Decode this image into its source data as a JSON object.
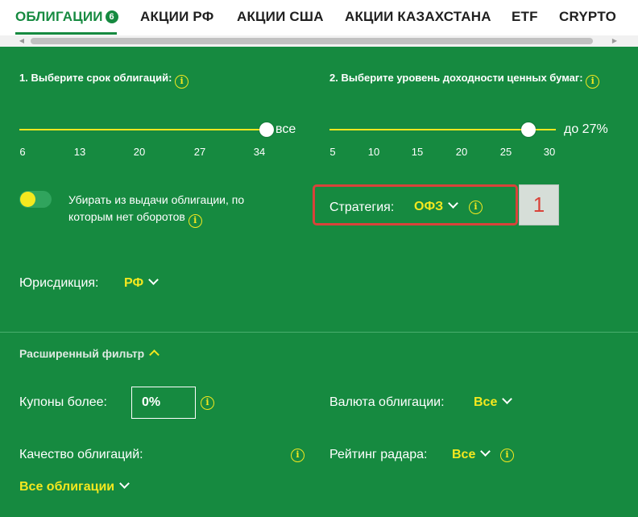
{
  "tabs": [
    {
      "label": "ОБЛИГАЦИИ",
      "badge": "6",
      "active": true
    },
    {
      "label": "АКЦИИ РФ"
    },
    {
      "label": "АКЦИИ США"
    },
    {
      "label": "АКЦИИ КАЗАХСТАНА"
    },
    {
      "label": "ETF"
    },
    {
      "label": "CRYPTO"
    }
  ],
  "colors": {
    "accent": "#168a40",
    "highlight": "#f4e81f",
    "annotation": "#d9433a"
  },
  "term": {
    "label": "1. Выберите срок облигаций:",
    "ticks": [
      "6",
      "13",
      "20",
      "27",
      "34"
    ],
    "value_text": "все",
    "selected_fraction": 1.0
  },
  "yield": {
    "label": "2. Выберите уровень доходности ценных бумаг:",
    "ticks": [
      "5",
      "10",
      "15",
      "20",
      "25",
      "30"
    ],
    "value_text": "до 27%",
    "selected_value": 27
  },
  "toggle": {
    "text_line1": "Убирать из выдачи облигации, по",
    "text_line2": "которым нет оборотов",
    "on": true
  },
  "strategy": {
    "label": "Стратегия:",
    "value": "ОФЗ"
  },
  "annotation": {
    "number": "1"
  },
  "jurisdiction": {
    "label": "Юрисдикция:",
    "value": "РФ"
  },
  "advanced": {
    "title": "Расширенный фильтр",
    "coupons": {
      "label": "Купоны более:",
      "value": "0%"
    },
    "currency": {
      "label": "Валюта облигации:",
      "value": "Все"
    },
    "quality": {
      "label": "Качество облигаций:",
      "value": "Все облигации"
    },
    "radar": {
      "label": "Рейтинг радара:",
      "value": "Все"
    }
  },
  "info_symbol": "i",
  "icons": [
    "info-icon",
    "chevron-down-icon",
    "chevron-up-icon",
    "scroll-left-arrow-icon",
    "scroll-right-arrow-icon"
  ]
}
